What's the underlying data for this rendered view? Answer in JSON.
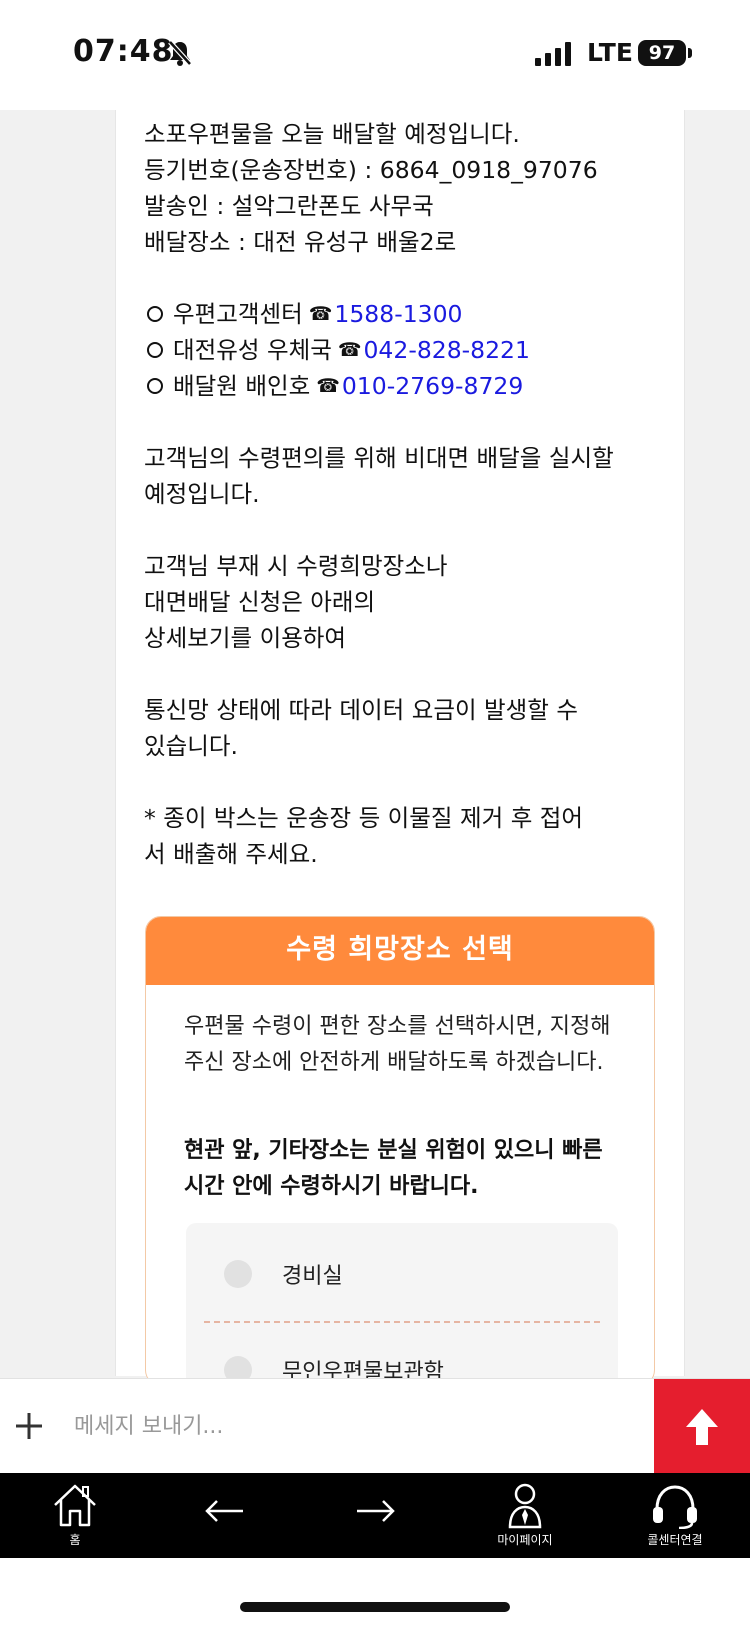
{
  "status_bar": {
    "time": "07:48",
    "network": "LTE",
    "battery": "97"
  },
  "message": {
    "line1": "소포우편물을 오늘 배달할 예정입니다.",
    "line2": "등기번호(운송장번호) : 6864_0918_97076",
    "line3": "발송인 : 설악그란폰도 사무국",
    "line4": "배달장소 : 대전 유성구 배울2로",
    "contacts": [
      {
        "label": "우편고객센터",
        "phone": "1588-1300"
      },
      {
        "label": "대전유성 우체국",
        "phone": "042-828-8221"
      },
      {
        "label": "배달원 배인호",
        "phone": "010-2769-8729"
      }
    ],
    "phone_glyph": "☎",
    "para1": "고객님의 수령편의를 위해 비대면 배달을 실시할 예정입니다.",
    "para2_l1": "고객님 부재 시 수령희망장소나",
    "para2_l2": "대면배달 신청은 아래의",
    "para2_l3": "상세보기를 이용하여",
    "para3": "통신망 상태에 따라 데이터 요금이 발생할 수 있습니다.",
    "para4": "* 종이 박스는 운송장 등 이물질 제거 후 접어서 배출해 주세요."
  },
  "pick_panel": {
    "title": "수령 희망장소 선택",
    "desc": "우편물 수령이 편한 장소를 선택하시면, 지정해주신 장소에 안전하게 배달하도록 하겠습니다.",
    "warning": "현관 앞, 기타장소는 분실 위험이 있으니 빠른 시간 안에 수령하시기 바랍니다.",
    "options": [
      "경비실",
      "무인우편물보관함"
    ]
  },
  "input_bar": {
    "placeholder": "메세지 보내기..."
  },
  "bottom_nav": {
    "home": "홈",
    "mypage": "마이페이지",
    "callcenter": "콜센터연결"
  },
  "colors": {
    "accent_orange": "#ff8a3c",
    "send_red": "#e51e2e",
    "link_blue": "#1a1adf"
  }
}
